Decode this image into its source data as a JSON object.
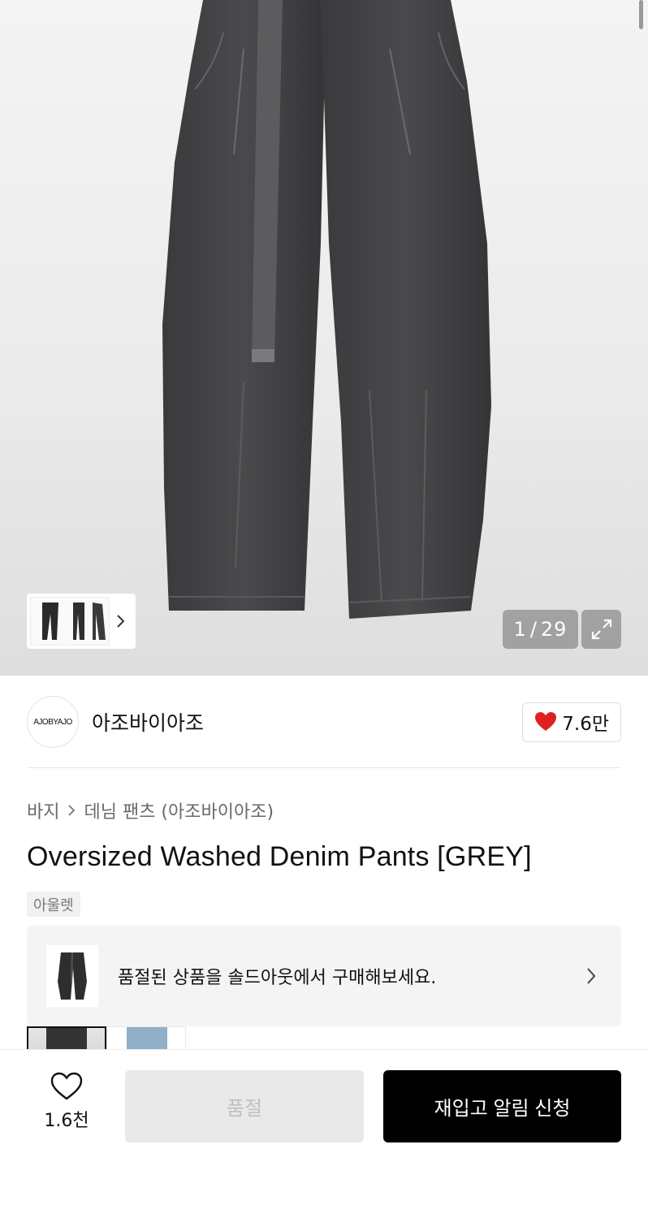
{
  "gallery": {
    "current": "1",
    "total": "29",
    "separator": "/"
  },
  "brand": {
    "logo_text": "AJOBYAJO",
    "name": "아조바이아조",
    "likes": "7.6만",
    "heart_color": "#e02020"
  },
  "breadcrumb": {
    "category": "바지",
    "subcategory": "데님 팬츠 (아조바이아조)"
  },
  "product": {
    "title": "Oversized Washed Denim Pants [GREY]",
    "tag": "아울렛"
  },
  "soldout_banner": {
    "text": "품절된 상품을 솔드아웃에서 구매해보세요."
  },
  "bottom": {
    "wish_count": "1.6천",
    "soldout_label": "품절",
    "restock_label": "재입고 알림 신청"
  }
}
